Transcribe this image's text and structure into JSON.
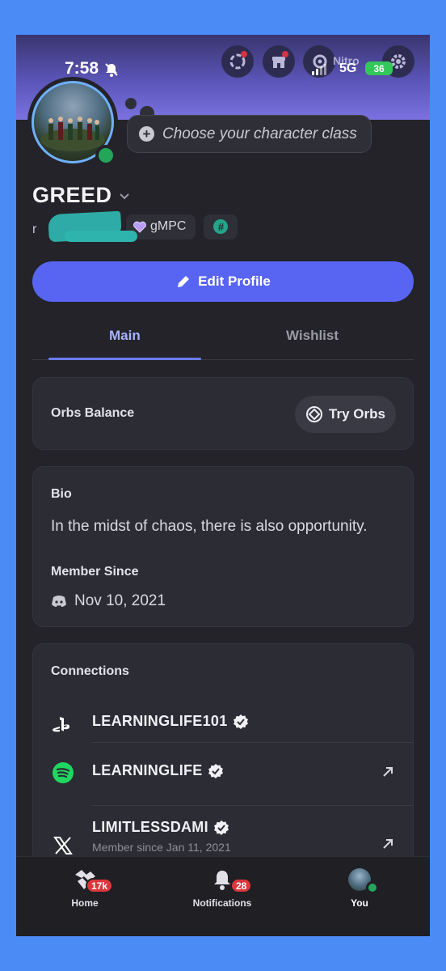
{
  "status_bar": {
    "time": "7:58",
    "network": "5G",
    "battery": "36"
  },
  "header": {
    "nitro_label": "Nitro",
    "icons": [
      "nitro-wheel-icon",
      "shop-icon",
      "nitro-icon",
      "settings-icon"
    ]
  },
  "profile": {
    "status_placeholder": "Choose your character class",
    "display_name": "GREED",
    "username_initial": "r",
    "guild_tag": "gMPC",
    "hash_label": "#"
  },
  "actions": {
    "edit_profile": "Edit Profile"
  },
  "tabs": [
    {
      "label": "Main",
      "active": true
    },
    {
      "label": "Wishlist",
      "active": false
    }
  ],
  "orbs": {
    "label": "Orbs Balance",
    "button": "Try Orbs"
  },
  "bio": {
    "heading": "Bio",
    "text": "In the midst of chaos, there is also opportunity.",
    "member_since_heading": "Member Since",
    "member_since": "Nov 10, 2021"
  },
  "connections": {
    "heading": "Connections",
    "items": [
      {
        "service": "playstation-icon",
        "name": "LEARNINGLIFE101",
        "verified": true,
        "link": false
      },
      {
        "service": "spotify-icon",
        "name": "LEARNINGLIFE",
        "verified": true,
        "link": true
      },
      {
        "service": "x-icon",
        "name": "LIMITLESSDAMI",
        "verified": true,
        "link": true,
        "subtext": "Member since Jan 11, 2021"
      }
    ]
  },
  "bottom_nav": {
    "home": {
      "label": "Home",
      "badge": "17k"
    },
    "notifications": {
      "label": "Notifications",
      "badge": "28"
    },
    "you": {
      "label": "You"
    }
  },
  "colors": {
    "accent": "#5865f2",
    "online": "#23a55a",
    "badge": "#da373c",
    "banner": "#6b63d6"
  }
}
